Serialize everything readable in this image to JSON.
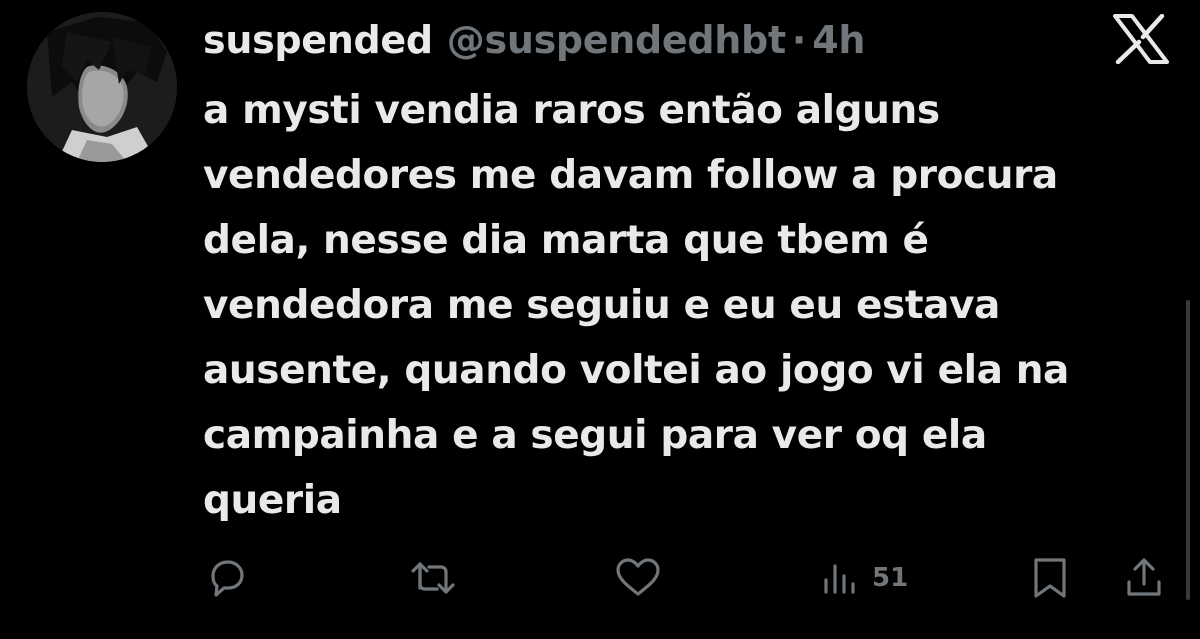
{
  "tweet": {
    "display_name": "suspended",
    "handle": "@suspendedhbt",
    "separator": "·",
    "time": "4h",
    "text_lines": [
      "a mysti vendia raros então alguns",
      "vendedores me davam follow a procura",
      "dela, nesse dia marta que tbem é",
      "vendedora me seguiu e eu eu estava",
      "ausente, quando voltei ao jogo vi ela na",
      "campainha e a segui para ver oq ela",
      "queria"
    ],
    "views": "51"
  },
  "icons": {
    "platform": "x-logo-icon",
    "reply": "reply-icon",
    "retweet": "retweet-icon",
    "like": "like-icon",
    "views": "views-icon",
    "bookmark": "bookmark-icon",
    "share": "share-icon"
  },
  "colors": {
    "background": "#000000",
    "primary_text": "#e7e9ea",
    "secondary_text": "#71767b"
  }
}
